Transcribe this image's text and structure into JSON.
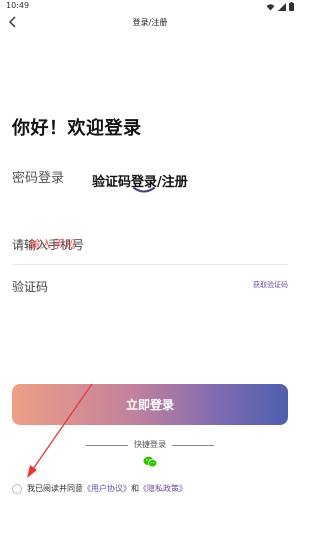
{
  "status": {
    "time": "10:49"
  },
  "nav": {
    "title": "登录/注册"
  },
  "greeting": "你好！欢迎登录",
  "tabs": {
    "password": "密码登录",
    "sms": "验证码登录/注册"
  },
  "phone": {
    "placeholder": "请输入手机号"
  },
  "code": {
    "label": "验证码",
    "get_code": "获取验证码"
  },
  "annotation": "输入手机",
  "login_button": "立即登录",
  "quick_login": "快捷登录",
  "agreement": {
    "prefix": "我已阅读并同意",
    "user_agreement": "《用户协议》",
    "and": "和",
    "privacy_policy": "《隐私政策》"
  },
  "colors": {
    "accent": "#6a4fa0",
    "gradient_start": "#ee9f86",
    "gradient_end": "#4e5fae",
    "annotation": "#e53935",
    "wechat": "#2dc100"
  },
  "icons": [
    "back-icon",
    "signal-icon",
    "wifi-icon",
    "battery-icon",
    "wechat-icon"
  ]
}
